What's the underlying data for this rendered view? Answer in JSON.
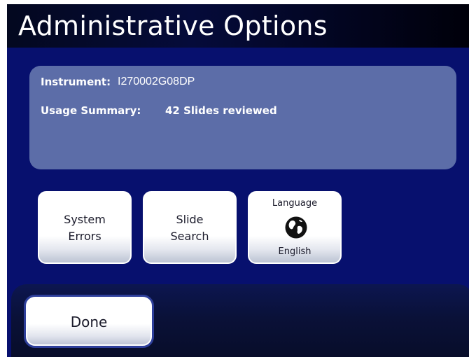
{
  "header": {
    "title": "Administrative Options"
  },
  "info": {
    "instrument_label": "Instrument:",
    "instrument_value": "I270002G08DP",
    "usage_label": "Usage Summary:",
    "usage_value": "42 Slides reviewed"
  },
  "tiles": {
    "system_errors": {
      "line1": "System",
      "line2": "Errors"
    },
    "slide_search": {
      "line1": "Slide",
      "line2": "Search"
    },
    "language": {
      "title": "Language",
      "icon": "globe-icon",
      "value": "English"
    }
  },
  "footer": {
    "done_label": "Done"
  },
  "colors": {
    "background": "#07106e",
    "panel": "#5c6da8",
    "title_bar": "#050b3a",
    "bottom_bar": "#0a1138",
    "done_border": "#2e3f9b"
  }
}
